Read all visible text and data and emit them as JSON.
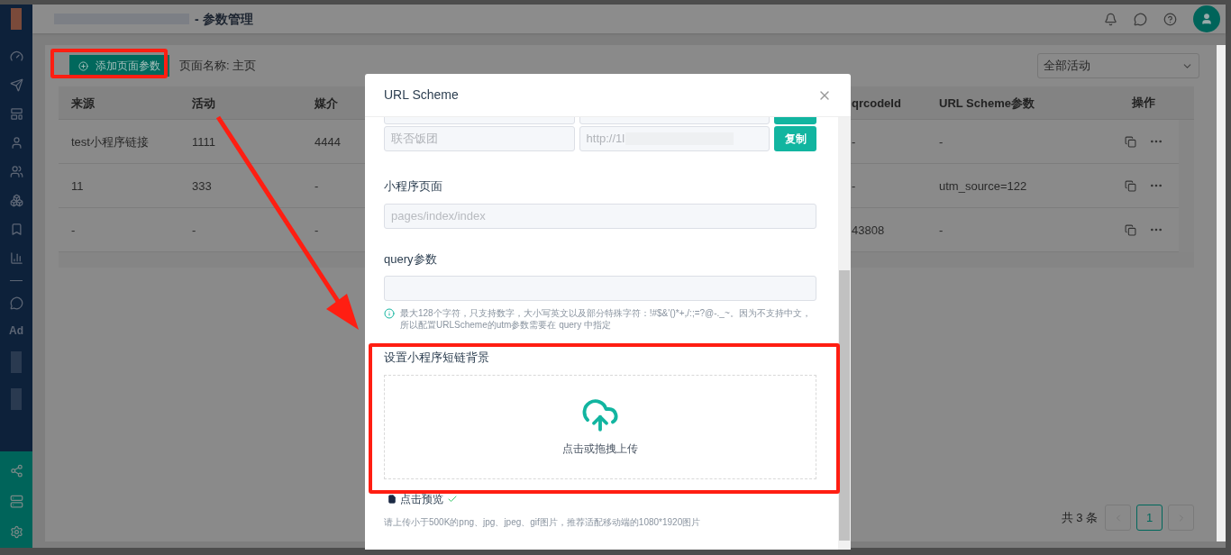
{
  "sidebar": {
    "ad_label": "Ad"
  },
  "header": {
    "title": "- 参数管理"
  },
  "toolbar": {
    "add_button": "添加页面参数",
    "page_name": "页面名称: 主页",
    "activity_select": "全部活动"
  },
  "table": {
    "columns": [
      "来源",
      "活动",
      "媒介",
      "qrcodeId",
      "URL Scheme参数",
      "操作"
    ],
    "rows": [
      {
        "cells": [
          "test小程序链接",
          "1111",
          "4444",
          "-",
          "-"
        ]
      },
      {
        "cells": [
          "11",
          "333",
          "-",
          "-",
          "utm_source=122"
        ]
      },
      {
        "cells": [
          "-",
          "-",
          "-",
          "43808",
          "-"
        ]
      }
    ]
  },
  "pagination": {
    "total": "共 3 条",
    "pages": [
      {
        "label": "1",
        "selected": true
      }
    ]
  },
  "dialog": {
    "title": "URL Scheme",
    "links": [
      {
        "name": "联否饭团",
        "url": "http://1l",
        "button": "复制"
      }
    ],
    "page_field": {
      "label": "小程序页面",
      "placeholder": "pages/index/index"
    },
    "query_field": {
      "label": "query参数",
      "hint": "最大128个字符，只支持数字，大小写英文以及部分特殊字符：!#$&'()*+,/:;=?@-._~。因为不支持中文，所以配置URLScheme的utm参数需要在 query 中指定"
    },
    "upload": {
      "label": "设置小程序短链背景",
      "text": "点击或拖拽上传",
      "file": "点击预览",
      "tip": "请上传小于500K的png、jpg、jpeg、gif图片，推荐适配移动端的1080*1920图片"
    }
  }
}
